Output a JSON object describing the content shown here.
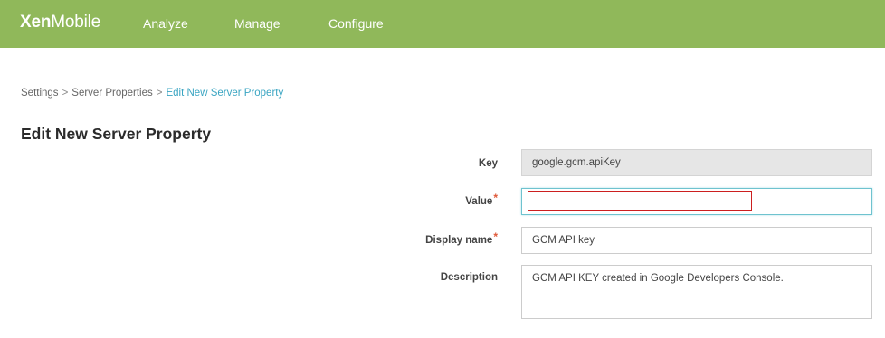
{
  "header": {
    "brand_bold": "Xen",
    "brand_light": "Mobile",
    "nav": [
      "Analyze",
      "Manage",
      "Configure"
    ]
  },
  "breadcrumb": {
    "items": [
      "Settings",
      "Server Properties"
    ],
    "separator": ">",
    "current": "Edit New Server Property"
  },
  "page": {
    "title": "Edit New Server Property"
  },
  "form": {
    "key_label": "Key",
    "key_value": "google.gcm.apiKey",
    "value_label": "Value",
    "value_value": "",
    "display_name_label": "Display name",
    "display_name_value": "GCM API key",
    "description_label": "Description",
    "description_value": "GCM API KEY created in Google Developers Console.",
    "required_marker": "*"
  },
  "colors": {
    "header_bg": "#90b85a",
    "breadcrumb_current": "#3aa5c2",
    "required": "#e05a3a",
    "highlight": "#cc1f1f"
  }
}
